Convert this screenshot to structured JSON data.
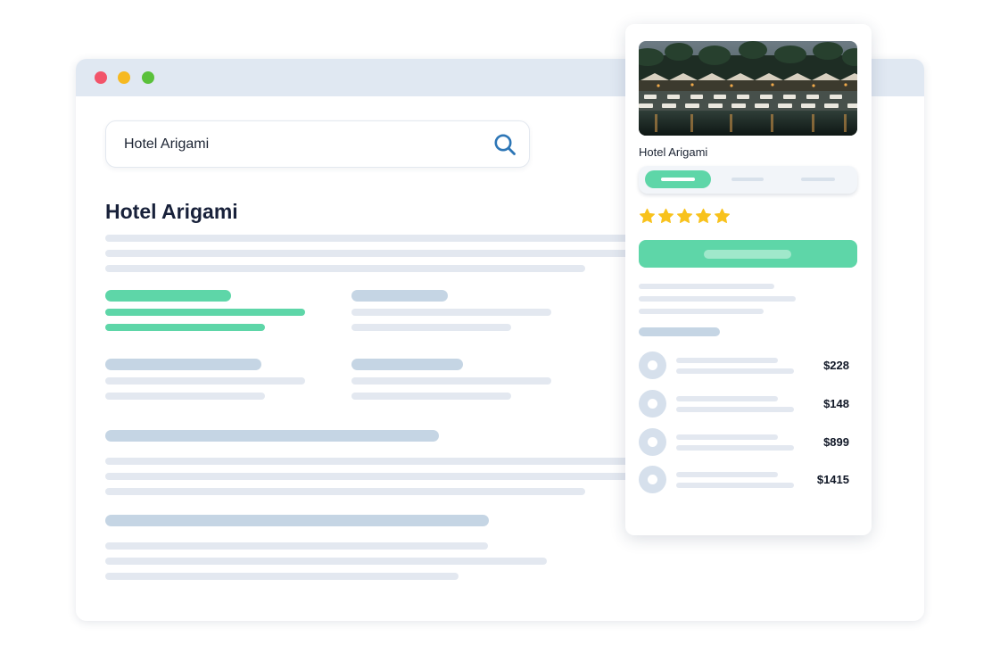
{
  "search": {
    "query": "Hotel Arigami"
  },
  "page": {
    "title": "Hotel Arigami"
  },
  "card": {
    "title": "Hotel Arigami",
    "rating": 5,
    "prices": [
      {
        "amount": "$228"
      },
      {
        "amount": "$148"
      },
      {
        "amount": "$899"
      },
      {
        "amount": "$1415"
      }
    ]
  },
  "colors": {
    "accent": "#5ed6a8",
    "star": "#f8c21c",
    "search_icon": "#2d76b6",
    "window_close": "#f2546a",
    "window_minimize": "#f6b921",
    "window_maximize": "#5ac13b"
  }
}
